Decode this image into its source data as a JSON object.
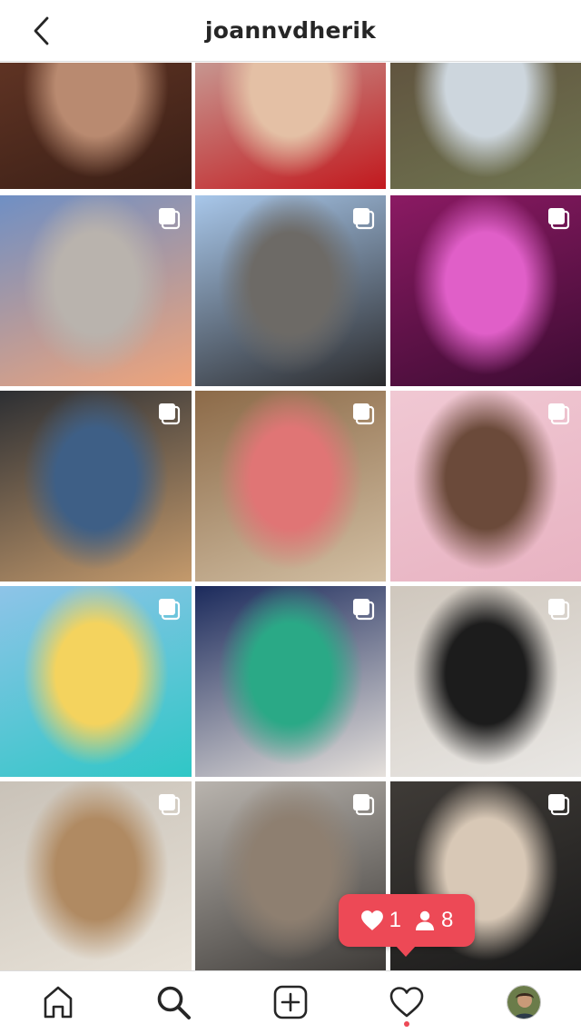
{
  "header": {
    "username": "joannvdherik",
    "back_icon": "chevron-left-icon"
  },
  "grid": {
    "columns": 3,
    "tiles": [
      {
        "name": "post-honey-top",
        "multiple": false,
        "colors": [
          "#6b3a28",
          "#3a1f16",
          "#b98a70"
        ]
      },
      {
        "name": "post-red-lingerie",
        "multiple": false,
        "colors": [
          "#c8bfb5",
          "#c2191e",
          "#e4c0a5"
        ]
      },
      {
        "name": "post-tree-outfit",
        "multiple": false,
        "colors": [
          "#5c4a3a",
          "#6f7450",
          "#cdd6dd"
        ]
      },
      {
        "name": "post-sunset-beach",
        "multiple": true,
        "colors": [
          "#6f8fc4",
          "#f0a47a",
          "#b9b3ad"
        ]
      },
      {
        "name": "post-blazer-parking",
        "multiple": true,
        "colors": [
          "#a8c7ea",
          "#2a2a2c",
          "#6d6a66"
        ]
      },
      {
        "name": "post-pink-light-duo",
        "multiple": true,
        "colors": [
          "#8b1a63",
          "#3d0c33",
          "#e05fc8"
        ]
      },
      {
        "name": "post-car-selfie",
        "multiple": true,
        "colors": [
          "#2d2f33",
          "#c49a6c",
          "#3e5f86"
        ]
      },
      {
        "name": "post-mirror-closet",
        "multiple": true,
        "colors": [
          "#8c6a48",
          "#d2bfa3",
          "#e07575"
        ]
      },
      {
        "name": "post-pink-hoodie-couple",
        "multiple": true,
        "colors": [
          "#f0c8d3",
          "#e8b3c2",
          "#6b4a3a"
        ]
      },
      {
        "name": "post-swing-ocean",
        "multiple": true,
        "colors": [
          "#8ec4e8",
          "#2fc7c6",
          "#f4d35e"
        ]
      },
      {
        "name": "post-runway-collage",
        "multiple": true,
        "colors": [
          "#1b2a5c",
          "#e6e1dc",
          "#2aa986"
        ]
      },
      {
        "name": "post-studio-skirt",
        "multiple": true,
        "colors": [
          "#cfc7bd",
          "#e9e7e4",
          "#1c1c1c"
        ]
      },
      {
        "name": "post-knit-vest",
        "multiple": true,
        "colors": [
          "#c9c2b8",
          "#e8e2d8",
          "#b08a62"
        ]
      },
      {
        "name": "post-camera-shoot",
        "multiple": true,
        "colors": [
          "#b9b4ae",
          "#3d3a37",
          "#8e7f70"
        ]
      },
      {
        "name": "post-friends-mirror",
        "multiple": true,
        "colors": [
          "#3f3b37",
          "#1a1a1a",
          "#d8c8b6"
        ]
      }
    ]
  },
  "notification": {
    "likes": "1",
    "followers": "8",
    "color": "#ed4956"
  },
  "tabbar": {
    "items": [
      "home-icon",
      "search-icon",
      "new-post-icon",
      "activity-icon",
      "profile-avatar"
    ],
    "active": "search-icon",
    "badge_color": "#ed4956"
  }
}
